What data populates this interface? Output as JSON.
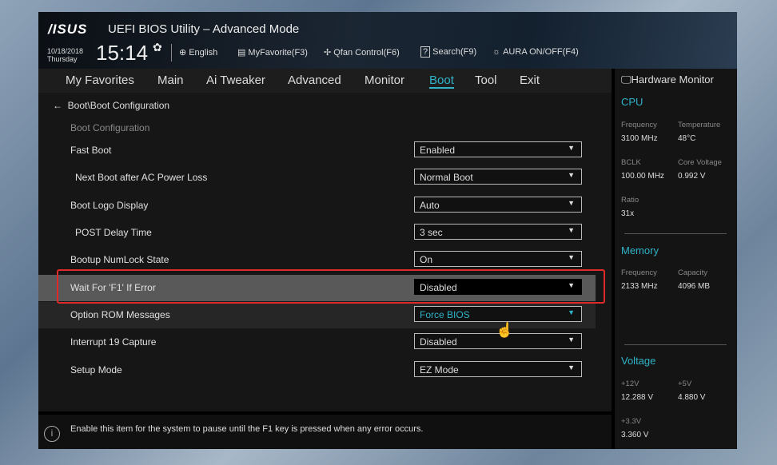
{
  "header": {
    "logo": "/ISUS",
    "title": "UEFI BIOS Utility – Advanced Mode",
    "date": "10/18/2018",
    "day": "Thursday",
    "time": "15:14",
    "toolbar": [
      {
        "icon": "globe-icon",
        "glyph": "⊕",
        "label": "English"
      },
      {
        "icon": "favorite-icon",
        "glyph": "▤",
        "label": "MyFavorite(F3)"
      },
      {
        "icon": "fan-icon",
        "glyph": "✢",
        "label": "Qfan Control(F6)"
      },
      {
        "icon": "search-help-icon",
        "glyph": "?",
        "label": "Search(F9)"
      },
      {
        "icon": "aura-icon",
        "glyph": "☼",
        "label": "AURA ON/OFF(F4)"
      }
    ]
  },
  "tabs": [
    "My Favorites",
    "Main",
    "Ai Tweaker",
    "Advanced",
    "Monitor",
    "Boot",
    "Tool",
    "Exit"
  ],
  "active_tab": "Boot",
  "breadcrumb": "Boot\\Boot Configuration",
  "section": "Boot Configuration",
  "settings": [
    {
      "label": "Fast Boot",
      "value": "Enabled"
    },
    {
      "label": "Next Boot after AC Power Loss",
      "value": "Normal Boot"
    },
    {
      "label": "Boot Logo Display",
      "value": "Auto"
    },
    {
      "label": "POST Delay Time",
      "value": "3 sec"
    },
    {
      "label": "Bootup NumLock State",
      "value": "On"
    },
    {
      "label": "Wait For 'F1' If Error",
      "value": "Disabled"
    },
    {
      "label": "Option ROM Messages",
      "value": "Force BIOS"
    },
    {
      "label": "Interrupt 19 Capture",
      "value": "Disabled"
    },
    {
      "label": "Setup Mode",
      "value": "EZ Mode"
    }
  ],
  "help": "Enable this item for the system to pause until the F1 key is pressed when any error occurs.",
  "hw": {
    "title": "Hardware Monitor",
    "cpu": "CPU",
    "cpu_freq_k": "Frequency",
    "cpu_freq": "3100 MHz",
    "temp_k": "Temperature",
    "temp": "48°C",
    "bclk_k": "BCLK",
    "bclk": "100.00 MHz",
    "cv_k": "Core Voltage",
    "cv": "0.992 V",
    "ratio_k": "Ratio",
    "ratio": "31x",
    "mem": "Memory",
    "mem_freq_k": "Frequency",
    "mem_freq": "2133 MHz",
    "cap_k": "Capacity",
    "cap": "4096 MB",
    "volt": "Voltage",
    "v12_k": "+12V",
    "v12": "12.288 V",
    "v5_k": "+5V",
    "v5": "4.880 V",
    "v33_k": "+3.3V",
    "v33": "3.360 V"
  },
  "colors": {
    "accent": "#2fb3c8",
    "highlight": "#e02a2a"
  }
}
